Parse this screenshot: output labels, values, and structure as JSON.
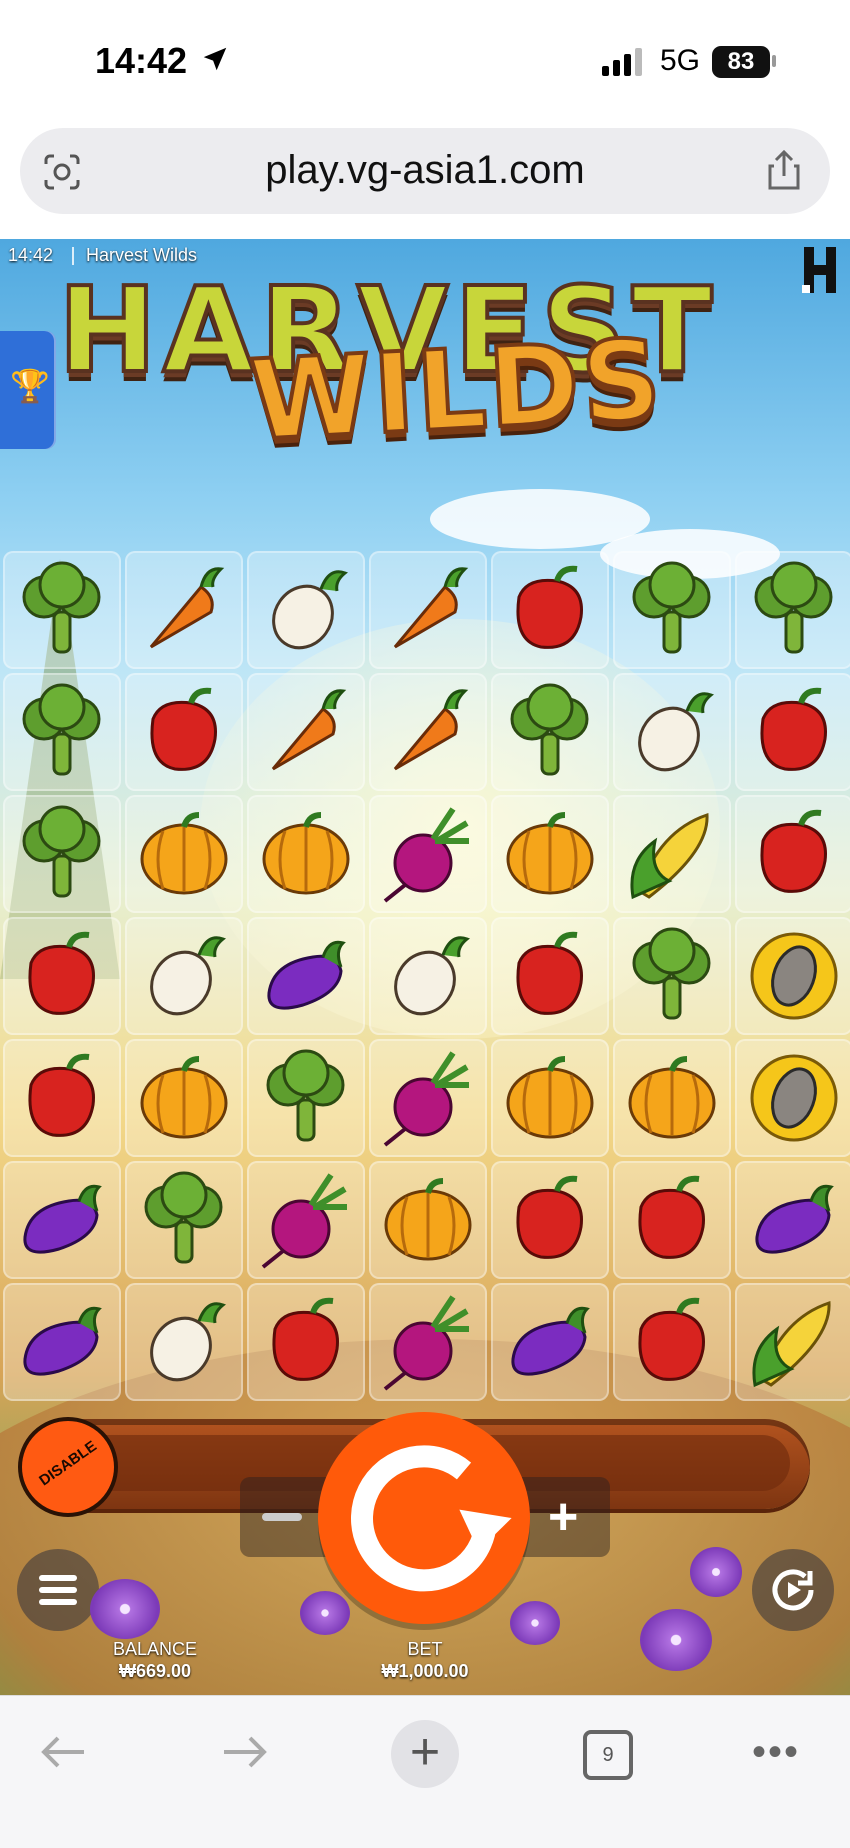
{
  "status_bar": {
    "time": "14:42",
    "network": "5G",
    "battery": "83"
  },
  "browser": {
    "url": "play.vg-asia1.com"
  },
  "game": {
    "hud_time": "14:42",
    "title": "Harvest Wilds",
    "logo_top": "HARVEST",
    "logo_bottom": "WILDS",
    "grid": [
      [
        "broccoli",
        "carrot",
        "radish",
        "carrot",
        "pepper",
        "broccoli",
        "broccoli"
      ],
      [
        "broccoli",
        "pepper",
        "carrot",
        "carrot",
        "broccoli",
        "radish",
        "pepper"
      ],
      [
        "broccoli",
        "pumpkin",
        "pumpkin",
        "beet",
        "pumpkin",
        "corn",
        "pepper"
      ],
      [
        "pepper",
        "radish",
        "eggplant",
        "radish",
        "pepper",
        "broccoli",
        "sunflower"
      ],
      [
        "pepper",
        "pumpkin",
        "broccoli",
        "beet",
        "pumpkin",
        "pumpkin",
        "sunflower"
      ],
      [
        "eggplant",
        "broccoli",
        "beet",
        "pumpkin",
        "pepper",
        "pepper",
        "eggplant"
      ],
      [
        "eggplant",
        "radish",
        "pepper",
        "beet",
        "eggplant",
        "pepper",
        "corn"
      ]
    ],
    "controls": {
      "disable_label": "DISABLE",
      "balance_label": "BALANCE",
      "balance_value": "₩669.00",
      "bet_label": "BET",
      "bet_value": "₩1,000.00"
    }
  },
  "toolbar": {
    "tabs_count": "9"
  },
  "colors": {
    "spin": "#ff5a0a",
    "accent_blue": "#2f6fd8"
  }
}
